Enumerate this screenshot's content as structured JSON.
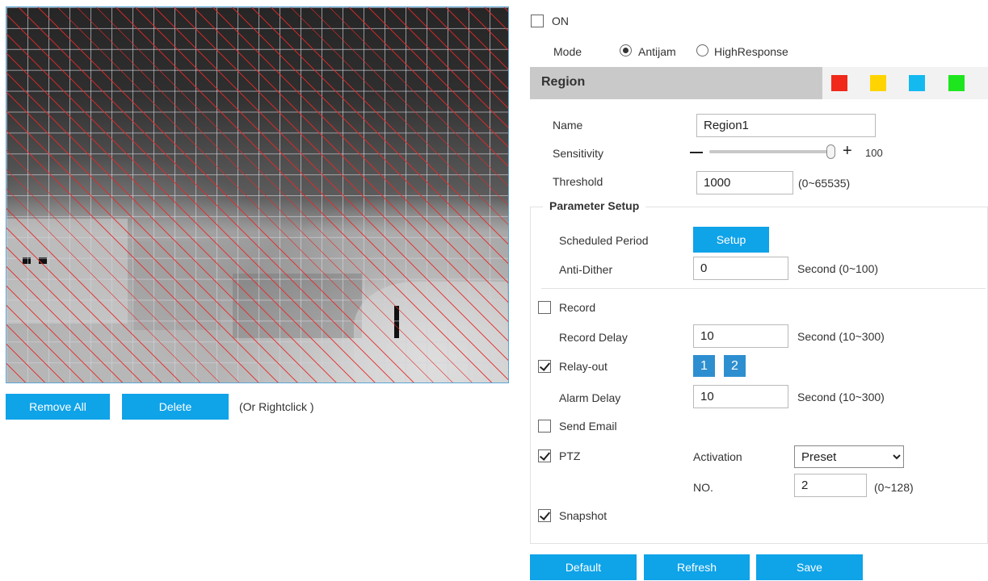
{
  "preview": {
    "remove_all_label": "Remove All",
    "delete_label": "Delete",
    "hint": "(Or Rightclick )"
  },
  "enable": {
    "label": "ON",
    "checked": false
  },
  "mode": {
    "label": "Mode",
    "options": [
      {
        "label": "Antijam",
        "selected": true
      },
      {
        "label": "HighResponse",
        "selected": false
      }
    ]
  },
  "region": {
    "title": "Region",
    "colors": [
      "#f0291a",
      "#ffd400",
      "#14b9f0",
      "#1ee61e"
    ],
    "name_label": "Name",
    "name_value": "Region1",
    "sensitivity_label": "Sensitivity",
    "sensitivity_value": "100",
    "sensitivity_fraction": 1.0,
    "threshold_label": "Threshold",
    "threshold_value": "1000",
    "threshold_range": "(0~65535)"
  },
  "parameter_setup": {
    "title": "Parameter Setup",
    "scheduled_period_label": "Scheduled Period",
    "setup_button": "Setup",
    "anti_dither_label": "Anti-Dither",
    "anti_dither_value": "0",
    "anti_dither_unit": "Second (0~100)",
    "record_label": "Record",
    "record_checked": false,
    "record_delay_label": "Record Delay",
    "record_delay_value": "10",
    "record_delay_unit": "Second (10~300)",
    "relay_out_label": "Relay-out",
    "relay_out_checked": true,
    "relay_channels": [
      "1",
      "2"
    ],
    "alarm_delay_label": "Alarm Delay",
    "alarm_delay_value": "10",
    "alarm_delay_unit": "Second (10~300)",
    "send_email_label": "Send Email",
    "send_email_checked": false,
    "ptz_label": "PTZ",
    "ptz_checked": true,
    "activation_label": "Activation",
    "activation_value": "Preset",
    "no_label": "NO.",
    "no_value": "2",
    "no_range": "(0~128)",
    "snapshot_label": "Snapshot",
    "snapshot_checked": true
  },
  "footer": {
    "default_label": "Default",
    "refresh_label": "Refresh",
    "save_label": "Save"
  }
}
